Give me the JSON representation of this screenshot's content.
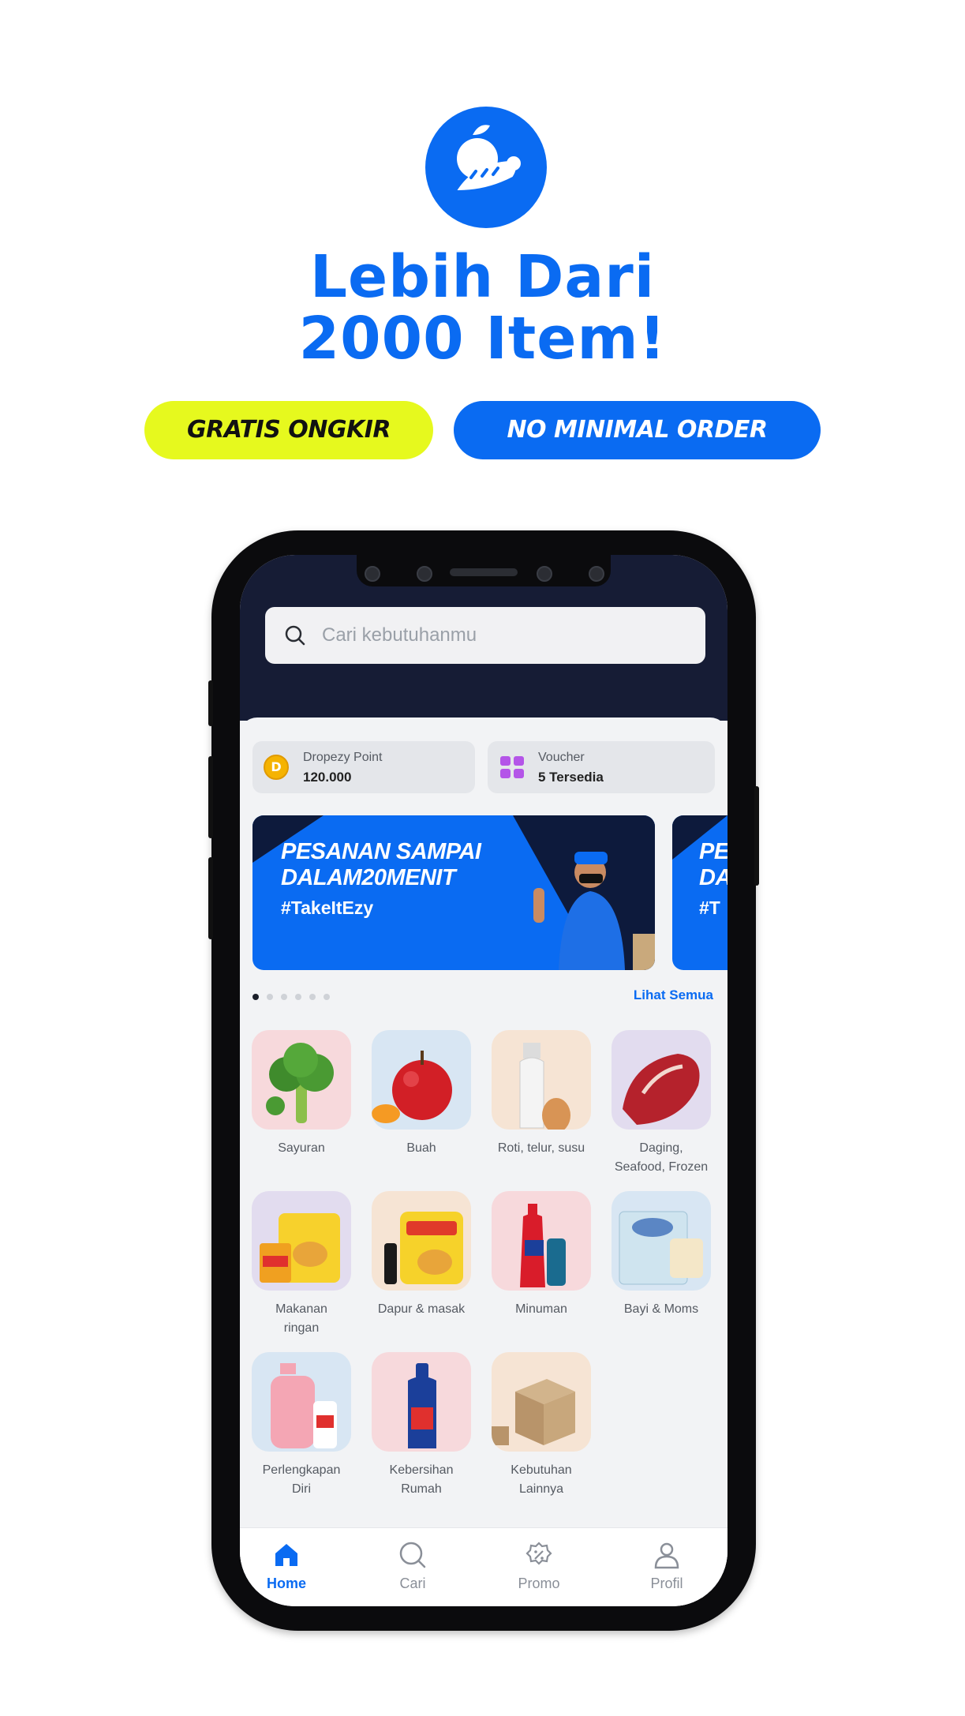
{
  "colors": {
    "brand": "#0a6bf2",
    "accent_yellow": "#e6f91e",
    "header_dark": "#161c35"
  },
  "promo": {
    "logo_icon": "fruit-basket-logo",
    "headline_line1": "Lebih Dari",
    "headline_line2": "2000 Item!",
    "pill_free_shipping": "GRATIS ONGKIR",
    "pill_no_min_order": "NO MINIMAL ORDER"
  },
  "app": {
    "search": {
      "placeholder": "Cari kebutuhanmu",
      "icon": "search-icon"
    },
    "points": {
      "label": "Dropezy Point",
      "value": "120.000",
      "icon": "coin-icon"
    },
    "voucher": {
      "label": "Voucher",
      "value": "5 Tersedia",
      "icon": "voucher-icon"
    },
    "banner": {
      "title_line1": "PESANAN SAMPAI",
      "title_line2": "DALAM20MENIT",
      "tag": "#TakeItEzy"
    },
    "banner_next": {
      "title_line1": "PE",
      "title_line2": "DA",
      "tag": "#T"
    },
    "carousel": {
      "total": 6,
      "active": 1
    },
    "see_all": "Lihat Semua",
    "categories": [
      {
        "label_1": "Sayuran",
        "label_2": "",
        "icon": "broccoli-icon",
        "bg": "#f7d9dc"
      },
      {
        "label_1": "Buah",
        "label_2": "",
        "icon": "apple-icon",
        "bg": "#d8e6f3"
      },
      {
        "label_1": "Roti, telur, susu",
        "label_2": "",
        "icon": "milk-egg-icon",
        "bg": "#f6e4d4"
      },
      {
        "label_1": "Daging,",
        "label_2": "Seafood, Frozen",
        "icon": "meat-icon",
        "bg": "#e2dcef"
      },
      {
        "label_1": "Makanan",
        "label_2": "ringan",
        "icon": "snacks-icon",
        "bg": "#e2dcef"
      },
      {
        "label_1": "Dapur & masak",
        "label_2": "",
        "icon": "cooking-oil-icon",
        "bg": "#f6e4d4"
      },
      {
        "label_1": "Minuman",
        "label_2": "",
        "icon": "drinks-icon",
        "bg": "#f7d9dc"
      },
      {
        "label_1": "Bayi & Moms",
        "label_2": "",
        "icon": "diapers-icon",
        "bg": "#d8e6f3"
      },
      {
        "label_1": "Perlengkapan",
        "label_2": "Diri",
        "icon": "soap-bottle-icon",
        "bg": "#d8e6f3"
      },
      {
        "label_1": "Kebersihan",
        "label_2": "Rumah",
        "icon": "cleaner-bottle-icon",
        "bg": "#f7d9dc"
      },
      {
        "label_1": "Kebutuhan",
        "label_2": "Lainnya",
        "icon": "box-icon",
        "bg": "#f6e4d4"
      }
    ],
    "nav": [
      {
        "label": "Home",
        "icon": "home-icon",
        "active": true
      },
      {
        "label": "Cari",
        "icon": "search-icon",
        "active": false
      },
      {
        "label": "Promo",
        "icon": "promo-icon",
        "active": false
      },
      {
        "label": "Profil",
        "icon": "profile-icon",
        "active": false
      }
    ]
  }
}
